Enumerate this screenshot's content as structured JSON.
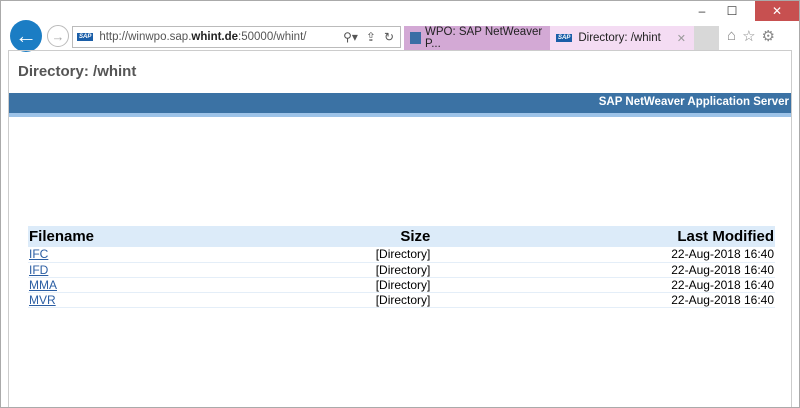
{
  "window": {
    "minimize": "–",
    "maximize": "☐",
    "close": "✕"
  },
  "address": {
    "prefix": "http://winwpo.sap.",
    "host": "whint.de",
    "suffix": ":50000/whint/"
  },
  "tabs": [
    {
      "label": "WPO: SAP NetWeaver P..."
    },
    {
      "label": "Directory: /whint",
      "close": "✕"
    }
  ],
  "page": {
    "title": "Directory: /whint",
    "banner": "SAP NetWeaver Application Server"
  },
  "table": {
    "headers": [
      "Filename",
      "Size",
      "Last Modified"
    ],
    "rows": [
      {
        "name": "IFC",
        "size": "[Directory]",
        "modified": "22-Aug-2018 16:40"
      },
      {
        "name": "IFD",
        "size": "[Directory]",
        "modified": "22-Aug-2018 16:40"
      },
      {
        "name": "MMA",
        "size": "[Directory]",
        "modified": "22-Aug-2018 16:40"
      },
      {
        "name": "MVR",
        "size": "[Directory]",
        "modified": "22-Aug-2018 16:40"
      }
    ]
  },
  "colors": {
    "banner": "#3b72a4",
    "header_row": "#dcebf9",
    "link": "#2b5ea3",
    "back_button": "#1b7dc4"
  }
}
